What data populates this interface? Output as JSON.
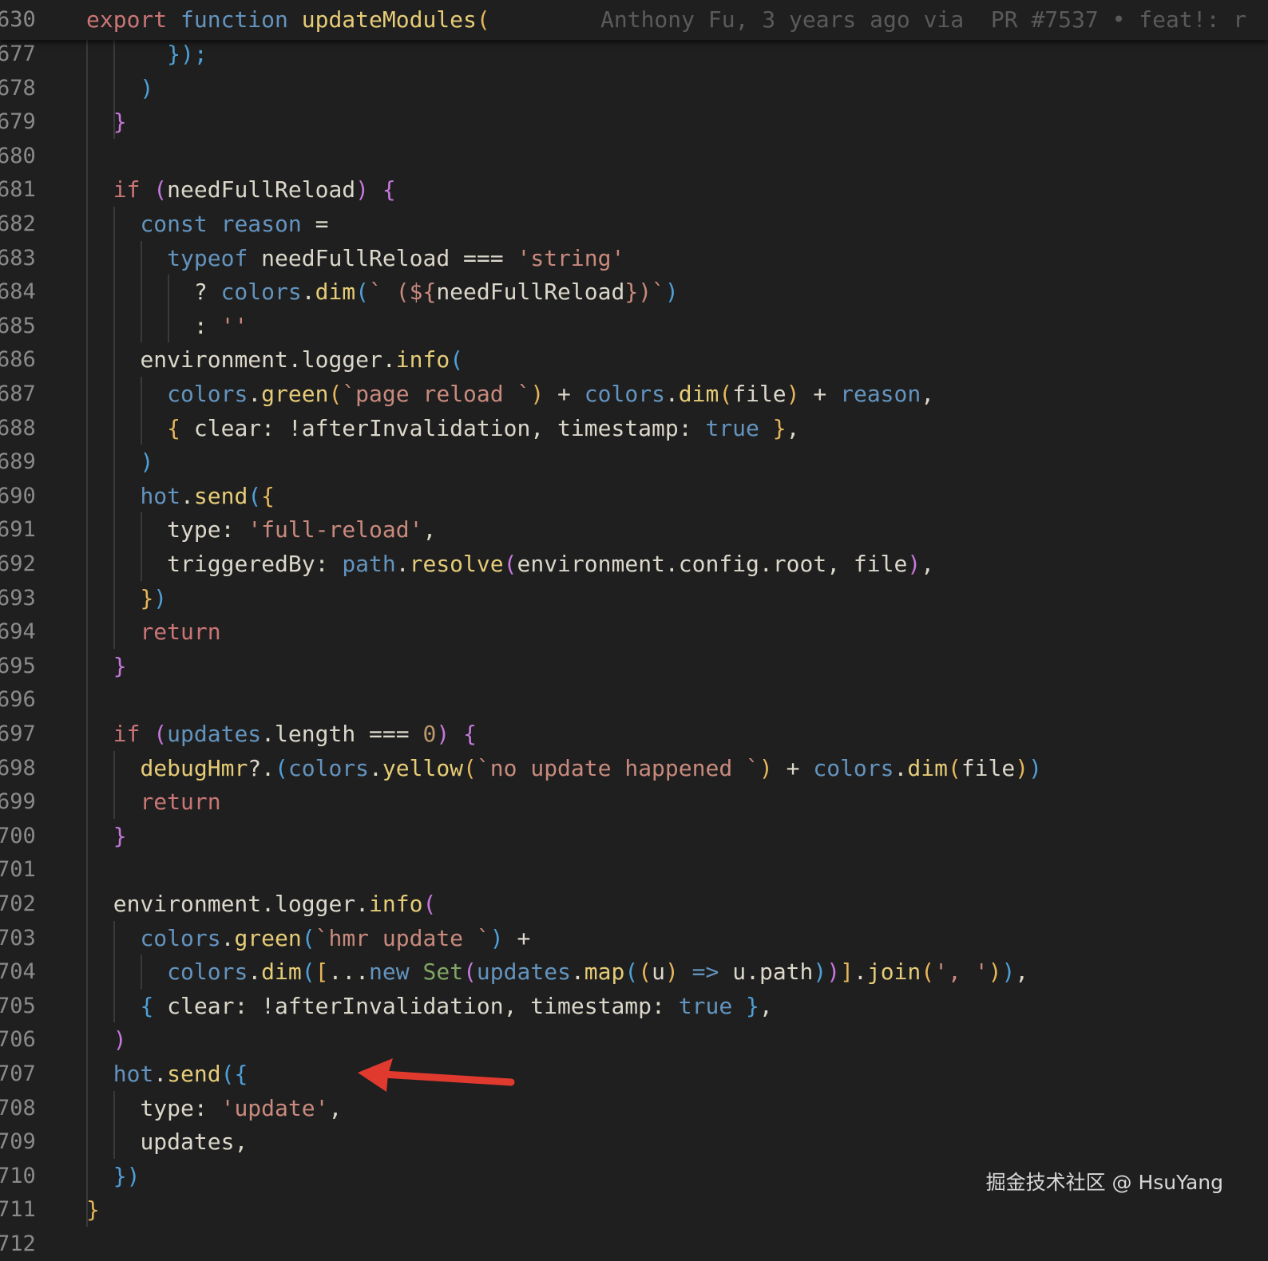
{
  "colors": {
    "background": "#1f1f1f",
    "arrow": "#e03a2f"
  },
  "sticky_header": {
    "line_number": "630",
    "blame": "Anthony Fu, 3 years ago via  PR #7537 • feat!: r"
  },
  "watermark": "掘金技术社区 @ HsuYang",
  "annotation": {
    "icon": "red-arrow-icon"
  },
  "lines": [
    {
      "num": "677",
      "tokens": [
        {
          "t": "      ",
          "c": "pl"
        },
        {
          "t": "});",
          "c": "p3"
        }
      ]
    },
    {
      "num": "678",
      "tokens": [
        {
          "t": "    ",
          "c": "pl"
        },
        {
          "t": ")",
          "c": "p3"
        }
      ]
    },
    {
      "num": "679",
      "tokens": [
        {
          "t": "  ",
          "c": "pl"
        },
        {
          "t": "}",
          "c": "p2"
        }
      ]
    },
    {
      "num": "680",
      "tokens": []
    },
    {
      "num": "681",
      "tokens": [
        {
          "t": "  ",
          "c": "pl"
        },
        {
          "t": "if",
          "c": "kw"
        },
        {
          "t": " ",
          "c": "pl"
        },
        {
          "t": "(",
          "c": "p2"
        },
        {
          "t": "needFullReload",
          "c": "var"
        },
        {
          "t": ")",
          "c": "p2"
        },
        {
          "t": " ",
          "c": "pl"
        },
        {
          "t": "{",
          "c": "p2"
        }
      ]
    },
    {
      "num": "682",
      "tokens": [
        {
          "t": "    ",
          "c": "pl"
        },
        {
          "t": "const",
          "c": "ns"
        },
        {
          "t": " ",
          "c": "pl"
        },
        {
          "t": "reason",
          "c": "ns"
        },
        {
          "t": " = ",
          "c": "pl"
        }
      ]
    },
    {
      "num": "683",
      "tokens": [
        {
          "t": "      ",
          "c": "pl"
        },
        {
          "t": "typeof",
          "c": "tf"
        },
        {
          "t": " needFullReload ",
          "c": "var"
        },
        {
          "t": "===",
          "c": "pl"
        },
        {
          "t": " ",
          "c": "pl"
        },
        {
          "t": "'string'",
          "c": "str"
        }
      ]
    },
    {
      "num": "684",
      "tokens": [
        {
          "t": "        ",
          "c": "pl"
        },
        {
          "t": "? ",
          "c": "pl"
        },
        {
          "t": "colors",
          "c": "ns"
        },
        {
          "t": ".",
          "c": "pl"
        },
        {
          "t": "dim",
          "c": "fnY"
        },
        {
          "t": "(",
          "c": "p3"
        },
        {
          "t": "` (${",
          "c": "str"
        },
        {
          "t": "needFullReload",
          "c": "var"
        },
        {
          "t": "})`",
          "c": "str"
        },
        {
          "t": ")",
          "c": "p3"
        }
      ]
    },
    {
      "num": "685",
      "tokens": [
        {
          "t": "        ",
          "c": "pl"
        },
        {
          "t": ": ",
          "c": "pl"
        },
        {
          "t": "''",
          "c": "str"
        }
      ]
    },
    {
      "num": "686",
      "tokens": [
        {
          "t": "    ",
          "c": "pl"
        },
        {
          "t": "environment",
          "c": "var"
        },
        {
          "t": ".",
          "c": "pl"
        },
        {
          "t": "logger",
          "c": "var"
        },
        {
          "t": ".",
          "c": "pl"
        },
        {
          "t": "info",
          "c": "fnY"
        },
        {
          "t": "(",
          "c": "p3"
        }
      ]
    },
    {
      "num": "687",
      "tokens": [
        {
          "t": "      ",
          "c": "pl"
        },
        {
          "t": "colors",
          "c": "ns"
        },
        {
          "t": ".",
          "c": "pl"
        },
        {
          "t": "green",
          "c": "fnY"
        },
        {
          "t": "(",
          "c": "p1"
        },
        {
          "t": "`page reload `",
          "c": "str"
        },
        {
          "t": ")",
          "c": "p1"
        },
        {
          "t": " + ",
          "c": "pl"
        },
        {
          "t": "colors",
          "c": "ns"
        },
        {
          "t": ".",
          "c": "pl"
        },
        {
          "t": "dim",
          "c": "fnY"
        },
        {
          "t": "(",
          "c": "p1"
        },
        {
          "t": "file",
          "c": "var"
        },
        {
          "t": ")",
          "c": "p1"
        },
        {
          "t": " + ",
          "c": "pl"
        },
        {
          "t": "reason",
          "c": "ns"
        },
        {
          "t": ",",
          "c": "pl"
        }
      ]
    },
    {
      "num": "688",
      "tokens": [
        {
          "t": "      ",
          "c": "pl"
        },
        {
          "t": "{",
          "c": "p1"
        },
        {
          "t": " clear: !afterInvalidation, timestamp: ",
          "c": "var"
        },
        {
          "t": "true",
          "c": "ns"
        },
        {
          "t": " ",
          "c": "pl"
        },
        {
          "t": "}",
          "c": "p1"
        },
        {
          "t": ",",
          "c": "pl"
        }
      ]
    },
    {
      "num": "689",
      "tokens": [
        {
          "t": "    ",
          "c": "pl"
        },
        {
          "t": ")",
          "c": "p3"
        }
      ]
    },
    {
      "num": "690",
      "tokens": [
        {
          "t": "    ",
          "c": "pl"
        },
        {
          "t": "hot",
          "c": "ns"
        },
        {
          "t": ".",
          "c": "pl"
        },
        {
          "t": "send",
          "c": "fnY"
        },
        {
          "t": "(",
          "c": "p3"
        },
        {
          "t": "{",
          "c": "p1"
        }
      ]
    },
    {
      "num": "691",
      "tokens": [
        {
          "t": "      ",
          "c": "pl"
        },
        {
          "t": "type: ",
          "c": "var"
        },
        {
          "t": "'full-reload'",
          "c": "str"
        },
        {
          "t": ",",
          "c": "pl"
        }
      ]
    },
    {
      "num": "692",
      "tokens": [
        {
          "t": "      ",
          "c": "pl"
        },
        {
          "t": "triggeredBy: ",
          "c": "var"
        },
        {
          "t": "path",
          "c": "ns"
        },
        {
          "t": ".",
          "c": "pl"
        },
        {
          "t": "resolve",
          "c": "fnY"
        },
        {
          "t": "(",
          "c": "p2"
        },
        {
          "t": "environment.config.root, file",
          "c": "var"
        },
        {
          "t": ")",
          "c": "p2"
        },
        {
          "t": ",",
          "c": "pl"
        }
      ]
    },
    {
      "num": "693",
      "tokens": [
        {
          "t": "    ",
          "c": "pl"
        },
        {
          "t": "}",
          "c": "p1"
        },
        {
          "t": ")",
          "c": "p3"
        }
      ]
    },
    {
      "num": "694",
      "tokens": [
        {
          "t": "    ",
          "c": "pl"
        },
        {
          "t": "return",
          "c": "kw"
        }
      ]
    },
    {
      "num": "695",
      "tokens": [
        {
          "t": "  ",
          "c": "pl"
        },
        {
          "t": "}",
          "c": "p2"
        }
      ]
    },
    {
      "num": "696",
      "tokens": []
    },
    {
      "num": "697",
      "tokens": [
        {
          "t": "  ",
          "c": "pl"
        },
        {
          "t": "if",
          "c": "kw"
        },
        {
          "t": " ",
          "c": "pl"
        },
        {
          "t": "(",
          "c": "p2"
        },
        {
          "t": "updates",
          "c": "ns"
        },
        {
          "t": ".",
          "c": "pl"
        },
        {
          "t": "length",
          "c": "var"
        },
        {
          "t": " === ",
          "c": "pl"
        },
        {
          "t": "0",
          "c": "v"
        },
        {
          "t": ")",
          "c": "p2"
        },
        {
          "t": " ",
          "c": "pl"
        },
        {
          "t": "{",
          "c": "p2"
        }
      ]
    },
    {
      "num": "698",
      "tokens": [
        {
          "t": "    ",
          "c": "pl"
        },
        {
          "t": "debugHmr",
          "c": "fnY"
        },
        {
          "t": "?.",
          "c": "pl"
        },
        {
          "t": "(",
          "c": "p3"
        },
        {
          "t": "colors",
          "c": "ns"
        },
        {
          "t": ".",
          "c": "pl"
        },
        {
          "t": "yellow",
          "c": "fnY"
        },
        {
          "t": "(",
          "c": "p1"
        },
        {
          "t": "`no update happened `",
          "c": "str"
        },
        {
          "t": ")",
          "c": "p1"
        },
        {
          "t": " + ",
          "c": "pl"
        },
        {
          "t": "colors",
          "c": "ns"
        },
        {
          "t": ".",
          "c": "pl"
        },
        {
          "t": "dim",
          "c": "fnY"
        },
        {
          "t": "(",
          "c": "p1"
        },
        {
          "t": "file",
          "c": "var"
        },
        {
          "t": ")",
          "c": "p1"
        },
        {
          "t": ")",
          "c": "p3"
        }
      ]
    },
    {
      "num": "699",
      "tokens": [
        {
          "t": "    ",
          "c": "pl"
        },
        {
          "t": "return",
          "c": "kw"
        }
      ]
    },
    {
      "num": "700",
      "tokens": [
        {
          "t": "  ",
          "c": "pl"
        },
        {
          "t": "}",
          "c": "p2"
        }
      ]
    },
    {
      "num": "701",
      "tokens": []
    },
    {
      "num": "702",
      "tokens": [
        {
          "t": "  ",
          "c": "pl"
        },
        {
          "t": "environment",
          "c": "var"
        },
        {
          "t": ".",
          "c": "pl"
        },
        {
          "t": "logger",
          "c": "var"
        },
        {
          "t": ".",
          "c": "pl"
        },
        {
          "t": "info",
          "c": "fnY"
        },
        {
          "t": "(",
          "c": "p2"
        }
      ]
    },
    {
      "num": "703",
      "tokens": [
        {
          "t": "    ",
          "c": "pl"
        },
        {
          "t": "colors",
          "c": "ns"
        },
        {
          "t": ".",
          "c": "pl"
        },
        {
          "t": "green",
          "c": "fnY"
        },
        {
          "t": "(",
          "c": "p3"
        },
        {
          "t": "`hmr update `",
          "c": "str"
        },
        {
          "t": ")",
          "c": "p3"
        },
        {
          "t": " +",
          "c": "pl"
        }
      ]
    },
    {
      "num": "704",
      "tokens": [
        {
          "t": "      ",
          "c": "pl"
        },
        {
          "t": "colors",
          "c": "ns"
        },
        {
          "t": ".",
          "c": "pl"
        },
        {
          "t": "dim",
          "c": "fnY"
        },
        {
          "t": "(",
          "c": "p3"
        },
        {
          "t": "[",
          "c": "p1"
        },
        {
          "t": "...",
          "c": "pl"
        },
        {
          "t": "new",
          "c": "tf"
        },
        {
          "t": " ",
          "c": "pl"
        },
        {
          "t": "Set",
          "c": "fn"
        },
        {
          "t": "(",
          "c": "p2"
        },
        {
          "t": "updates",
          "c": "ns"
        },
        {
          "t": ".",
          "c": "pl"
        },
        {
          "t": "map",
          "c": "fnY"
        },
        {
          "t": "(",
          "c": "p3"
        },
        {
          "t": "(",
          "c": "p1"
        },
        {
          "t": "u",
          "c": "var"
        },
        {
          "t": ")",
          "c": "p1"
        },
        {
          "t": " ",
          "c": "pl"
        },
        {
          "t": "=>",
          "c": "tf"
        },
        {
          "t": " u.path",
          "c": "var"
        },
        {
          "t": ")",
          "c": "p3"
        },
        {
          "t": ")",
          "c": "p2"
        },
        {
          "t": "]",
          "c": "p1"
        },
        {
          "t": ".",
          "c": "pl"
        },
        {
          "t": "join",
          "c": "fnY"
        },
        {
          "t": "(",
          "c": "p1"
        },
        {
          "t": "', '",
          "c": "str"
        },
        {
          "t": ")",
          "c": "p1"
        },
        {
          "t": ")",
          "c": "p3"
        },
        {
          "t": ",",
          "c": "pl"
        }
      ]
    },
    {
      "num": "705",
      "tokens": [
        {
          "t": "    ",
          "c": "pl"
        },
        {
          "t": "{",
          "c": "p3"
        },
        {
          "t": " clear: !afterInvalidation, timestamp: ",
          "c": "var"
        },
        {
          "t": "true",
          "c": "ns"
        },
        {
          "t": " ",
          "c": "pl"
        },
        {
          "t": "}",
          "c": "p3"
        },
        {
          "t": ",",
          "c": "pl"
        }
      ]
    },
    {
      "num": "706",
      "tokens": [
        {
          "t": "  ",
          "c": "pl"
        },
        {
          "t": ")",
          "c": "p2"
        }
      ]
    },
    {
      "num": "707",
      "tokens": [
        {
          "t": "  ",
          "c": "pl"
        },
        {
          "t": "hot",
          "c": "ns"
        },
        {
          "t": ".",
          "c": "pl"
        },
        {
          "t": "send",
          "c": "fnY"
        },
        {
          "t": "(",
          "c": "p3"
        },
        {
          "t": "{",
          "c": "p3"
        }
      ]
    },
    {
      "num": "708",
      "tokens": [
        {
          "t": "    ",
          "c": "pl"
        },
        {
          "t": "type: ",
          "c": "var"
        },
        {
          "t": "'update'",
          "c": "str"
        },
        {
          "t": ",",
          "c": "pl"
        }
      ]
    },
    {
      "num": "709",
      "tokens": [
        {
          "t": "    ",
          "c": "pl"
        },
        {
          "t": "updates,",
          "c": "var"
        }
      ]
    },
    {
      "num": "710",
      "tokens": [
        {
          "t": "  ",
          "c": "pl"
        },
        {
          "t": "}",
          "c": "p3"
        },
        {
          "t": ")",
          "c": "p3"
        }
      ]
    },
    {
      "num": "711",
      "tokens": [
        {
          "t": "}",
          "c": "p1"
        }
      ]
    },
    {
      "num": "712",
      "tokens": []
    }
  ],
  "header_tokens": [
    {
      "t": "export",
      "c": "kw"
    },
    {
      "t": " ",
      "c": "pl"
    },
    {
      "t": "function",
      "c": "ns"
    },
    {
      "t": " ",
      "c": "pl"
    },
    {
      "t": "updateModules",
      "c": "fnY"
    },
    {
      "t": "(",
      "c": "p1"
    }
  ]
}
